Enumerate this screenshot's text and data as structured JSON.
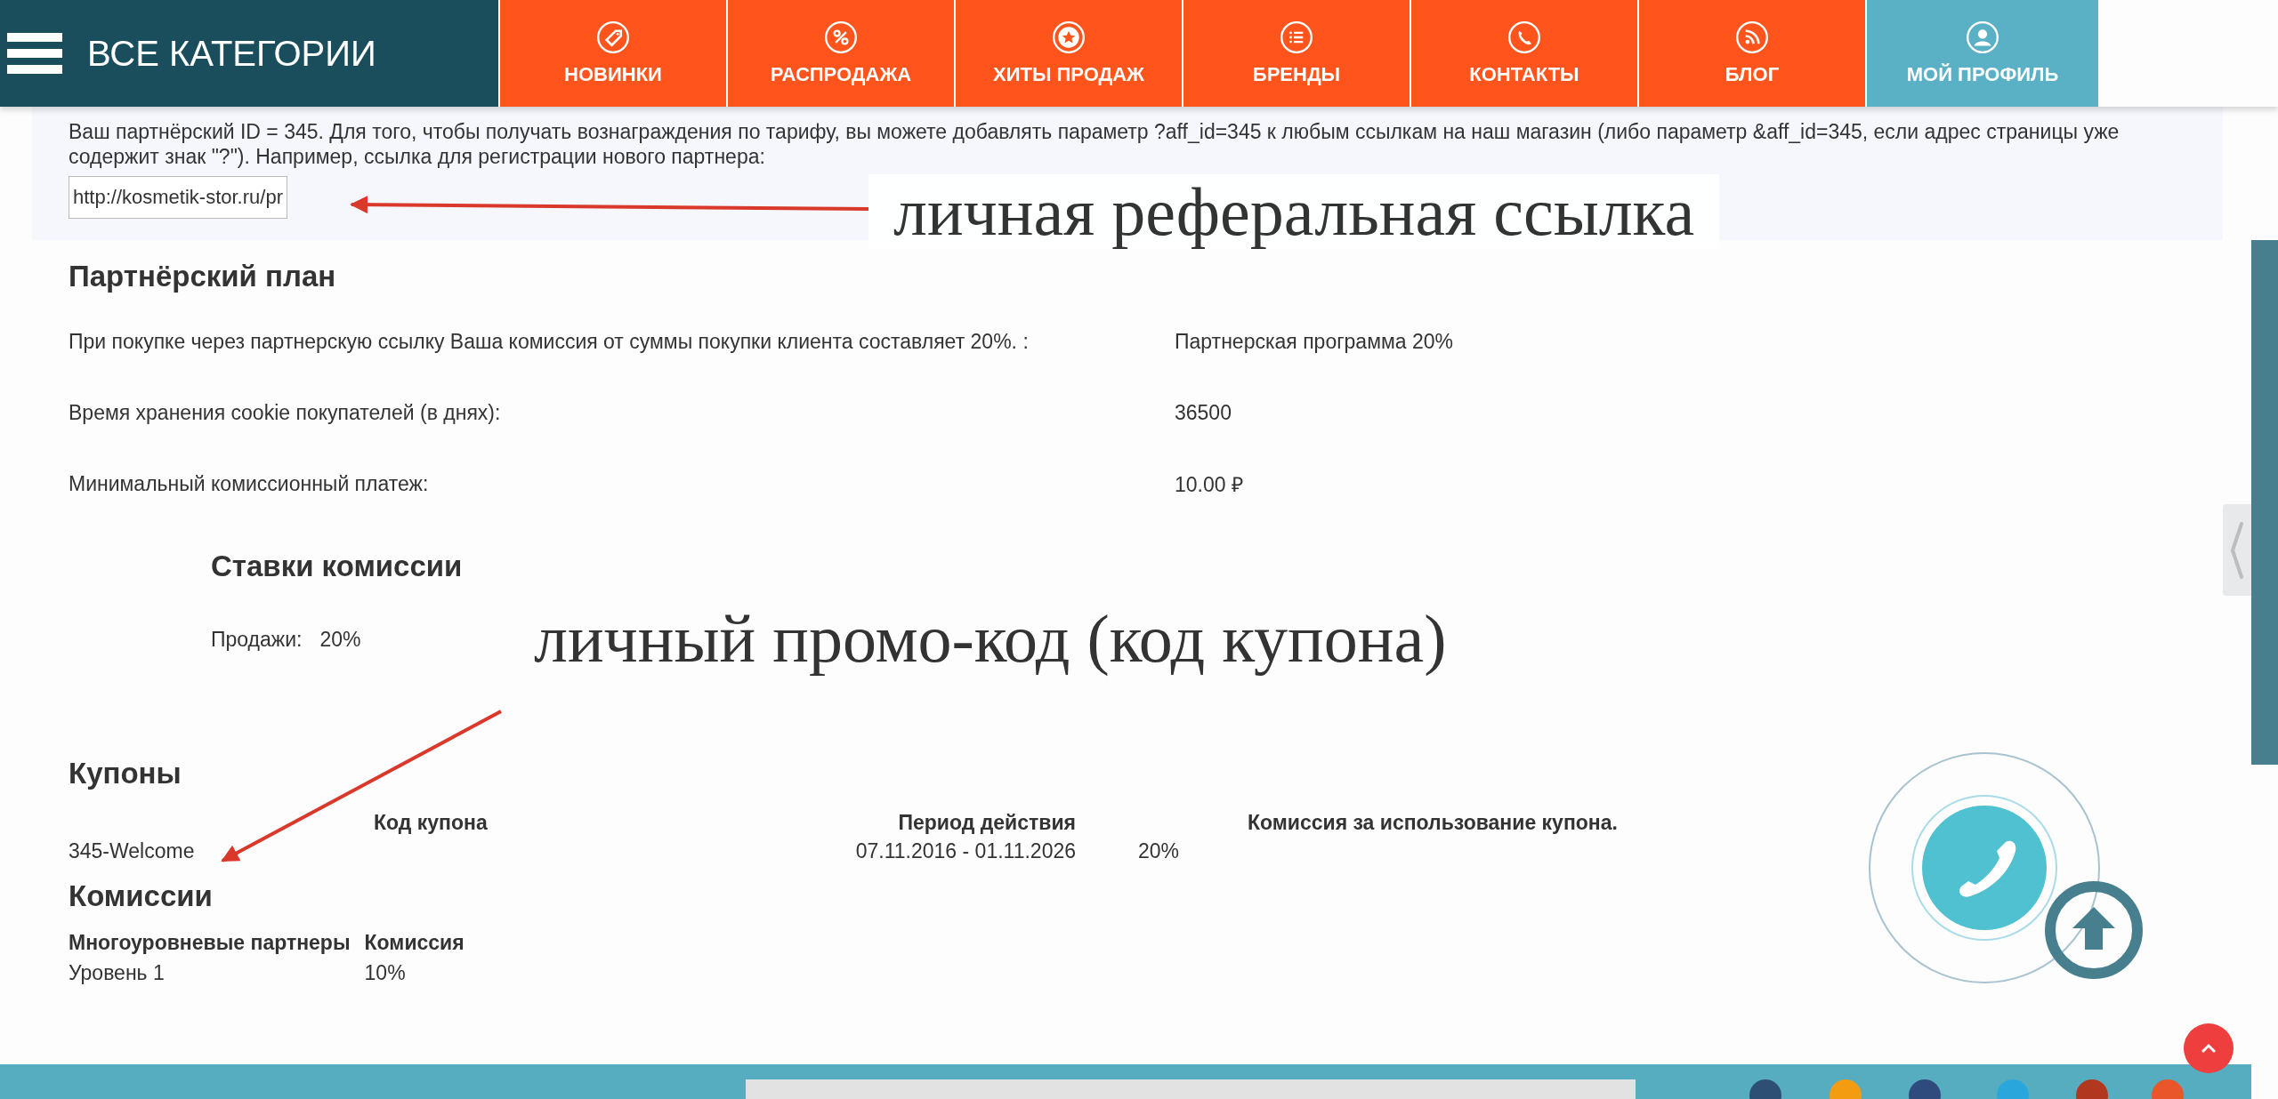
{
  "nav": {
    "categories_label": "ВСЕ КАТЕГОРИИ",
    "items": [
      {
        "label": "НОВИНКИ",
        "selected": false
      },
      {
        "label": "РАСПРОДАЖА",
        "selected": false
      },
      {
        "label": "ХИТЫ ПРОДАЖ",
        "selected": false
      },
      {
        "label": "БРЕНДЫ",
        "selected": false
      },
      {
        "label": "КОНТАКТЫ",
        "selected": false
      },
      {
        "label": "БЛОГ",
        "selected": false
      },
      {
        "label": "МОЙ ПРОФИЛЬ",
        "selected": true
      }
    ]
  },
  "intro": {
    "text": "Ваш партнёрский ID = 345. Для того, чтобы получать вознаграждения по тарифу, вы можете добавлять параметр ?aff_id=345 к любым ссылкам на наш магазин (либо параметр &aff_id=345, если адрес страницы уже содержит знак \"?\"). Например, ссылка для регистрации нового партнера:",
    "link_value": "http://kosmetik-stor.ru/pr"
  },
  "partner_plan": {
    "title": "Партнёрский план",
    "rows": [
      {
        "label": "При покупке через партнерскую ссылку Ваша комиссия от суммы покупки клиента составляет 20%. :",
        "value": "Партнерская программа 20%"
      },
      {
        "label": "Время хранения cookie покупателей (в днях):",
        "value": "36500"
      },
      {
        "label": "Минимальный комиссионный платеж:",
        "value": "10.00 ₽"
      }
    ]
  },
  "rates": {
    "title": "Ставки комиссии",
    "label": "Продажи:",
    "value": "20%"
  },
  "coupons": {
    "title": "Купоны",
    "columns": [
      "Код купона",
      "Период действия",
      "Комиссия за использование купона."
    ],
    "rows": [
      {
        "code": "345-Welcome",
        "period": "07.11.2016 - 01.11.2026",
        "commission": "20%"
      }
    ]
  },
  "commissions": {
    "title": "Комиссии",
    "columns": [
      "Многоуровневые партнеры",
      "Комиссия"
    ],
    "rows": [
      {
        "level": "Уровень 1",
        "rate": "10%"
      }
    ]
  },
  "annotations": [
    {
      "text": "личная реферальная ссылка"
    },
    {
      "text": "личный промо-код (код купона)"
    }
  ]
}
